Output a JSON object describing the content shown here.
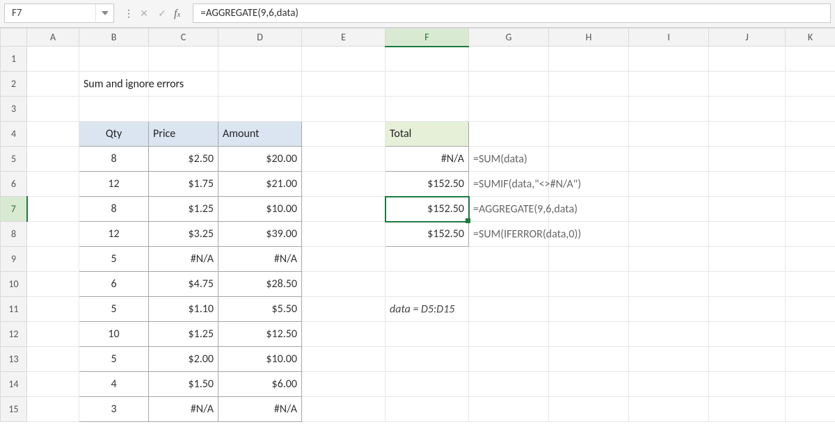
{
  "namebox": "F7",
  "formula_bar": "=AGGREGATE(9,6,data)",
  "columns": [
    "A",
    "B",
    "C",
    "D",
    "E",
    "F",
    "G",
    "H",
    "I",
    "J",
    "K"
  ],
  "active_column": "F",
  "active_row": 7,
  "title": "Sum and ignore errors",
  "data_table": {
    "headers": {
      "qty": "Qty",
      "price": "Price",
      "amount": "Amount"
    },
    "rows": [
      {
        "qty": "8",
        "price": "$2.50",
        "amount": "$20.00"
      },
      {
        "qty": "12",
        "price": "$1.75",
        "amount": "$21.00"
      },
      {
        "qty": "8",
        "price": "$1.25",
        "amount": "$10.00"
      },
      {
        "qty": "12",
        "price": "$3.25",
        "amount": "$39.00"
      },
      {
        "qty": "5",
        "price": "#N/A",
        "amount": "#N/A"
      },
      {
        "qty": "6",
        "price": "$4.75",
        "amount": "$28.50"
      },
      {
        "qty": "5",
        "price": "$1.10",
        "amount": "$5.50"
      },
      {
        "qty": "10",
        "price": "$1.25",
        "amount": "$12.50"
      },
      {
        "qty": "5",
        "price": "$2.00",
        "amount": "$10.00"
      },
      {
        "qty": "4",
        "price": "$1.50",
        "amount": "$6.00"
      },
      {
        "qty": "3",
        "price": "#N/A",
        "amount": "#N/A"
      }
    ]
  },
  "totals": {
    "header": "Total",
    "rows": [
      {
        "value": "#N/A",
        "formula": "=SUM(data)"
      },
      {
        "value": "$152.50",
        "formula": "=SUMIF(data,\"<>#N/A\")"
      },
      {
        "value": "$152.50",
        "formula": "=AGGREGATE(9,6,data)"
      },
      {
        "value": "$152.50",
        "formula": "=SUM(IFERROR(data,0))"
      }
    ]
  },
  "note": "data = D5:D15",
  "row_numbers": [
    1,
    2,
    3,
    4,
    5,
    6,
    7,
    8,
    9,
    10,
    11,
    12,
    13,
    14,
    15
  ]
}
